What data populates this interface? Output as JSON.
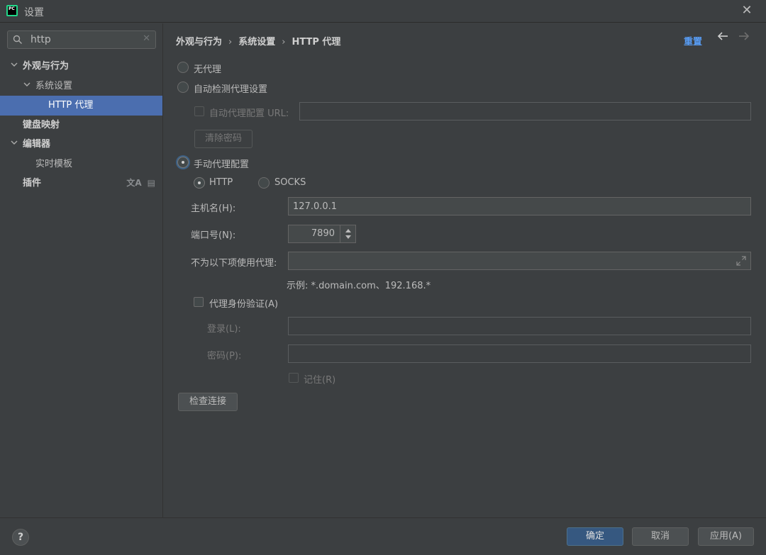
{
  "window": {
    "title": "设置"
  },
  "search": {
    "value": "http",
    "clear_glyph": "✕"
  },
  "tree": {
    "items": [
      {
        "label": "外观与行为",
        "bold": true,
        "expanded": true
      },
      {
        "label": "系统设置",
        "bold": false,
        "expanded": true
      },
      {
        "label": "HTTP 代理",
        "bold": false,
        "selected": true
      },
      {
        "label": "键盘映射",
        "bold": true
      },
      {
        "label": "编辑器",
        "bold": true,
        "expanded": true
      },
      {
        "label": "实时模板",
        "bold": false
      },
      {
        "label": "插件",
        "bold": true
      }
    ]
  },
  "breadcrumb": {
    "items": [
      "外观与行为",
      "系统设置",
      "HTTP 代理"
    ],
    "separator": "›"
  },
  "header": {
    "reset_label": "重置"
  },
  "proxy": {
    "no_proxy_label": "无代理",
    "auto_detect_label": "自动检测代理设置",
    "auto_url_label": "自动代理配置 URL:",
    "auto_url_value": "",
    "clear_password_label": "清除密码",
    "manual_label": "手动代理配置",
    "selected_mode": "manual",
    "http_label": "HTTP",
    "socks_label": "SOCKS",
    "selected_type": "HTTP",
    "host_label": "主机名(H):",
    "host_value": "127.0.0.1",
    "port_label": "端口号(N):",
    "port_value": "7890",
    "no_proxy_for_label": "不为以下项使用代理:",
    "no_proxy_for_value": "",
    "example_text": "示例: *.domain.com、192.168.*",
    "auth_label": "代理身份验证(A)",
    "auth_checked": false,
    "login_label": "登录(L):",
    "login_value": "",
    "password_label": "密码(P):",
    "password_value": "",
    "remember_label": "记住(R)",
    "check_connection_label": "检查连接"
  },
  "footer": {
    "help_label": "?",
    "ok_label": "确定",
    "cancel_label": "取消",
    "apply_label": "应用(A)"
  },
  "colors": {
    "background": "#3c3f41",
    "selection": "#4b6eaf",
    "link": "#589df6",
    "primary_button": "#365880",
    "logo": "#21d789"
  }
}
